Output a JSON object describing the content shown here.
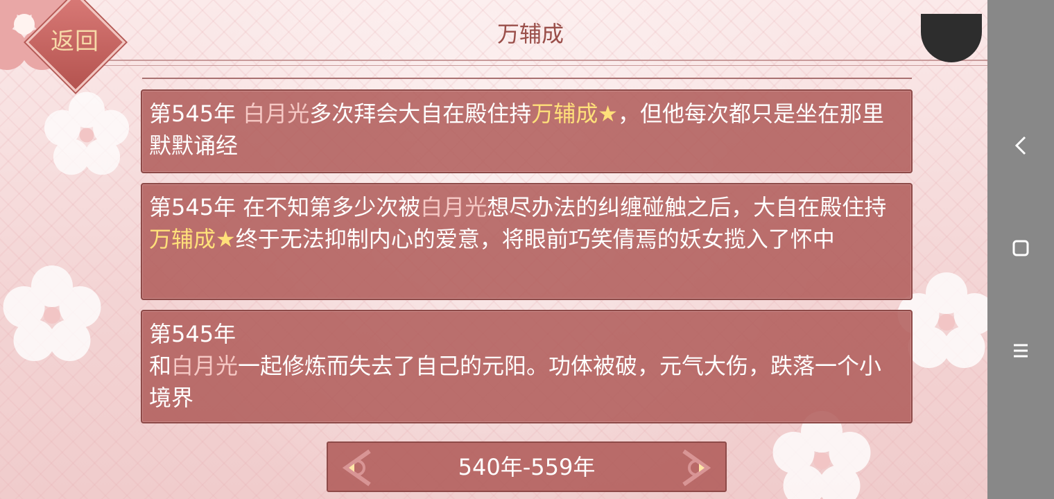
{
  "header": {
    "back_label": "返回",
    "title": "万辅成"
  },
  "events": [
    {
      "year": "第545年",
      "parts": [
        {
          "text": "白月光",
          "style": "name"
        },
        {
          "text": "多次拜会大自在殿住持",
          "style": "plain"
        },
        {
          "text": "万辅成★",
          "style": "hero"
        },
        {
          "text": "，但他每次都只是坐在那里默默诵经",
          "style": "plain"
        }
      ]
    },
    {
      "year": "第545年",
      "parts": [
        {
          "text": "在不知第多少次被",
          "style": "plain"
        },
        {
          "text": "白月光",
          "style": "name"
        },
        {
          "text": "想尽办法的纠缠碰触之后，大自在殿住持",
          "style": "plain"
        },
        {
          "text": "万辅成★",
          "style": "hero"
        },
        {
          "text": "终于无法抑制内心的爱意，将眼前巧笑倩焉的妖女揽入了怀中",
          "style": "plain"
        }
      ]
    },
    {
      "year": "第545年",
      "parts": [
        {
          "text": "和",
          "style": "plain"
        },
        {
          "text": "白月光",
          "style": "name"
        },
        {
          "text": "一起修炼而失去了自己的元阳。功体被破，元气大伤，跌落一个小境界",
          "style": "plain"
        }
      ]
    }
  ],
  "pager": {
    "range_label": "540年-559年"
  },
  "colors": {
    "name_highlight": "#f6c9c5",
    "hero_highlight": "#ffe07a",
    "card_bg": "#b05c5a"
  },
  "system_nav": {
    "back_icon": "chevron-left-icon",
    "home_icon": "square-icon",
    "menu_icon": "hamburger-icon"
  }
}
